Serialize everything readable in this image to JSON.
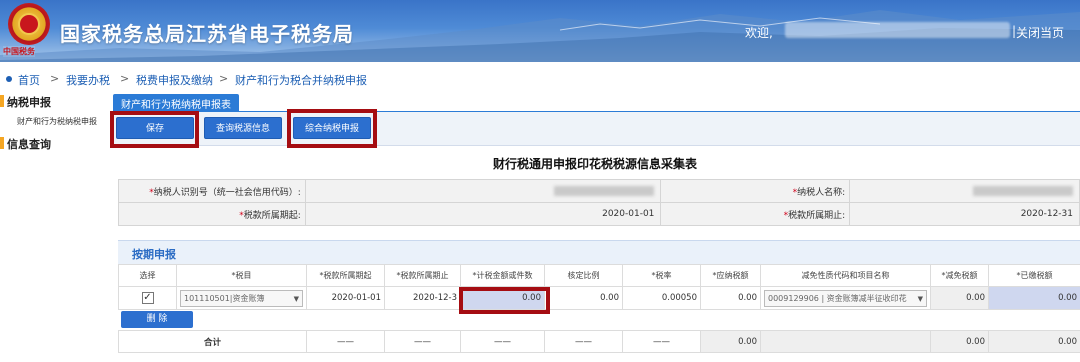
{
  "header": {
    "site_title": "国家税务总局江苏省电子税务局",
    "emblem_text": "中国税务",
    "welcome_label": "欢迎,",
    "close_label": "关闭当页",
    "separator": "|"
  },
  "breadcrumb": {
    "items": [
      "首页",
      "我要办税",
      "税费申报及缴纳",
      "财产和行为税合并纳税申报"
    ],
    "sep": ">"
  },
  "sidebar": {
    "groups": [
      {
        "label": "纳税申报",
        "items": [
          "财产和行为税纳税申报"
        ]
      },
      {
        "label": "信息查询",
        "items": []
      }
    ]
  },
  "tab": {
    "label": "财产和行为税纳税申报表"
  },
  "toolbar": {
    "save": "保存",
    "query": "查询税源信息",
    "combined": "综合纳税申报"
  },
  "form": {
    "title": "财行税通用申报印花税税源信息采集表",
    "taxpayer_id_label": "纳税人识别号（统一社会信用代码）:",
    "taxpayer_name_label": "纳税人名称:",
    "period_start_label": "税款所属期起:",
    "period_start_value": "2020-01-01",
    "period_end_label": "税款所属期止:",
    "period_end_value": "2020-12-31",
    "required_mark": "*"
  },
  "section": {
    "title": "按期申报"
  },
  "table": {
    "headers": [
      "选择",
      "*税目",
      "*税款所属期起",
      "*税款所属期止",
      "*计税金额或件数",
      "核定比例",
      "*税率",
      "*应纳税额",
      "减免性质代码和项目名称",
      "*减免税额",
      "*已缴税额"
    ],
    "row": {
      "checked": "✓",
      "tax_item": "101110501|资金账簿",
      "start": "2020-01-01",
      "end": "2020-12-3",
      "taxable_amount": "0.00",
      "ratio": "0.00",
      "rate": "0.00050",
      "payable": "0.00",
      "relief_code": "0009129906 | 资金账簿减半征收印花",
      "relief_amount": "0.00",
      "paid": "0.00"
    },
    "delete_label": "删 除",
    "total_label": "合计",
    "dash": "——",
    "total_payable": "0.00",
    "total_relief": "0.00",
    "total_paid": "0.00"
  },
  "colors": {
    "accent": "#2c6fcf",
    "highlight_box": "#a50d12",
    "required": "#d0021b"
  }
}
